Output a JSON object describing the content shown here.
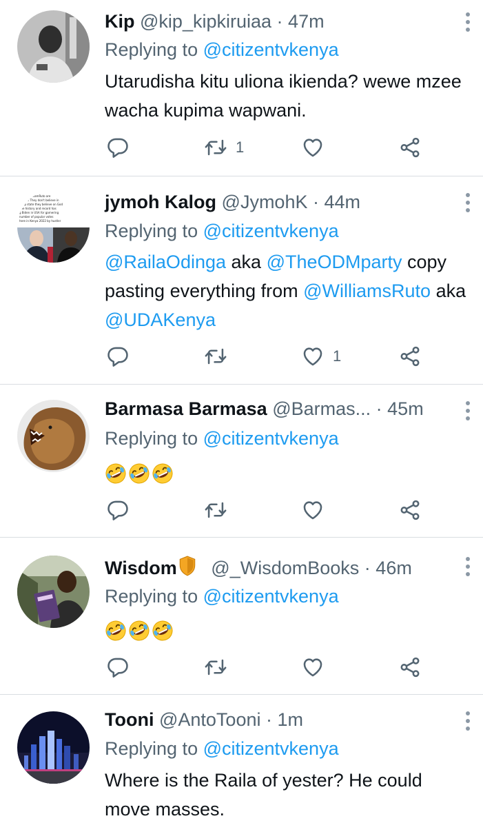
{
  "tweets": [
    {
      "name": "Kip",
      "handle": "@kip_kipkiruiaa",
      "time": "47m",
      "replying_label": "Replying to ",
      "replying_to": "@citizentvkenya",
      "text": "Utarudisha kitu uliona ikienda? wewe mzee wacha kupima wapwani.",
      "retweets": "1",
      "likes": ""
    },
    {
      "name": "jymoh Kalog",
      "handle": "@JymohK",
      "time": "44m",
      "replying_label": "Replying to ",
      "replying_to": "@citizentvkenya",
      "text_parts": {
        "m1": "@RailaOdinga",
        "t1": " aka ",
        "m2": "@TheODMparty",
        "t2": " copy pasting everything from ",
        "m3": "@WilliamsRuto",
        "t3": " aka ",
        "m4": "@UDAKenya"
      },
      "avatar_caption": "and WilliamRuto are the rather They don't believe in sys deep state they believe on God and ugle The history and record has become g Biden in USA for garnering the highest number of popular votes expect the same here in Kenya 2022 by hustler number one William Ruto",
      "retweets": "",
      "likes": "1"
    },
    {
      "name": "Barmasa Barmasa",
      "handle": "@Barmas...",
      "time": "45m",
      "replying_label": "Replying to ",
      "replying_to": "@citizentvkenya",
      "emojis": [
        "rolling-on-floor-laughing",
        "rolling-on-floor-laughing",
        "rolling-on-floor-laughing"
      ],
      "retweets": "",
      "likes": ""
    },
    {
      "name": "Wisdom",
      "handle": "@_WisdomBooks",
      "time": "46m",
      "replying_label": "Replying to ",
      "replying_to": "@citizentvkenya",
      "emojis": [
        "rolling-on-floor-laughing",
        "rolling-on-floor-laughing",
        "rolling-on-floor-laughing"
      ],
      "retweets": "",
      "likes": ""
    },
    {
      "name": "Tooni",
      "handle": "@AntoTooni",
      "time": "1m",
      "replying_label": "Replying to ",
      "replying_to": "@citizentvkenya",
      "text": "Where is the Raila of yester? He could move masses.",
      "retweets": "",
      "likes": ""
    }
  ],
  "dot": "·",
  "colors": {
    "link": "#1d9bf0",
    "muted": "#536471",
    "text": "#0f1419",
    "divider": "#d9dde1"
  },
  "icons": {
    "reply": "reply-icon",
    "retweet": "retweet-icon",
    "like": "like-icon",
    "share": "share-icon",
    "more": "more-icon"
  }
}
